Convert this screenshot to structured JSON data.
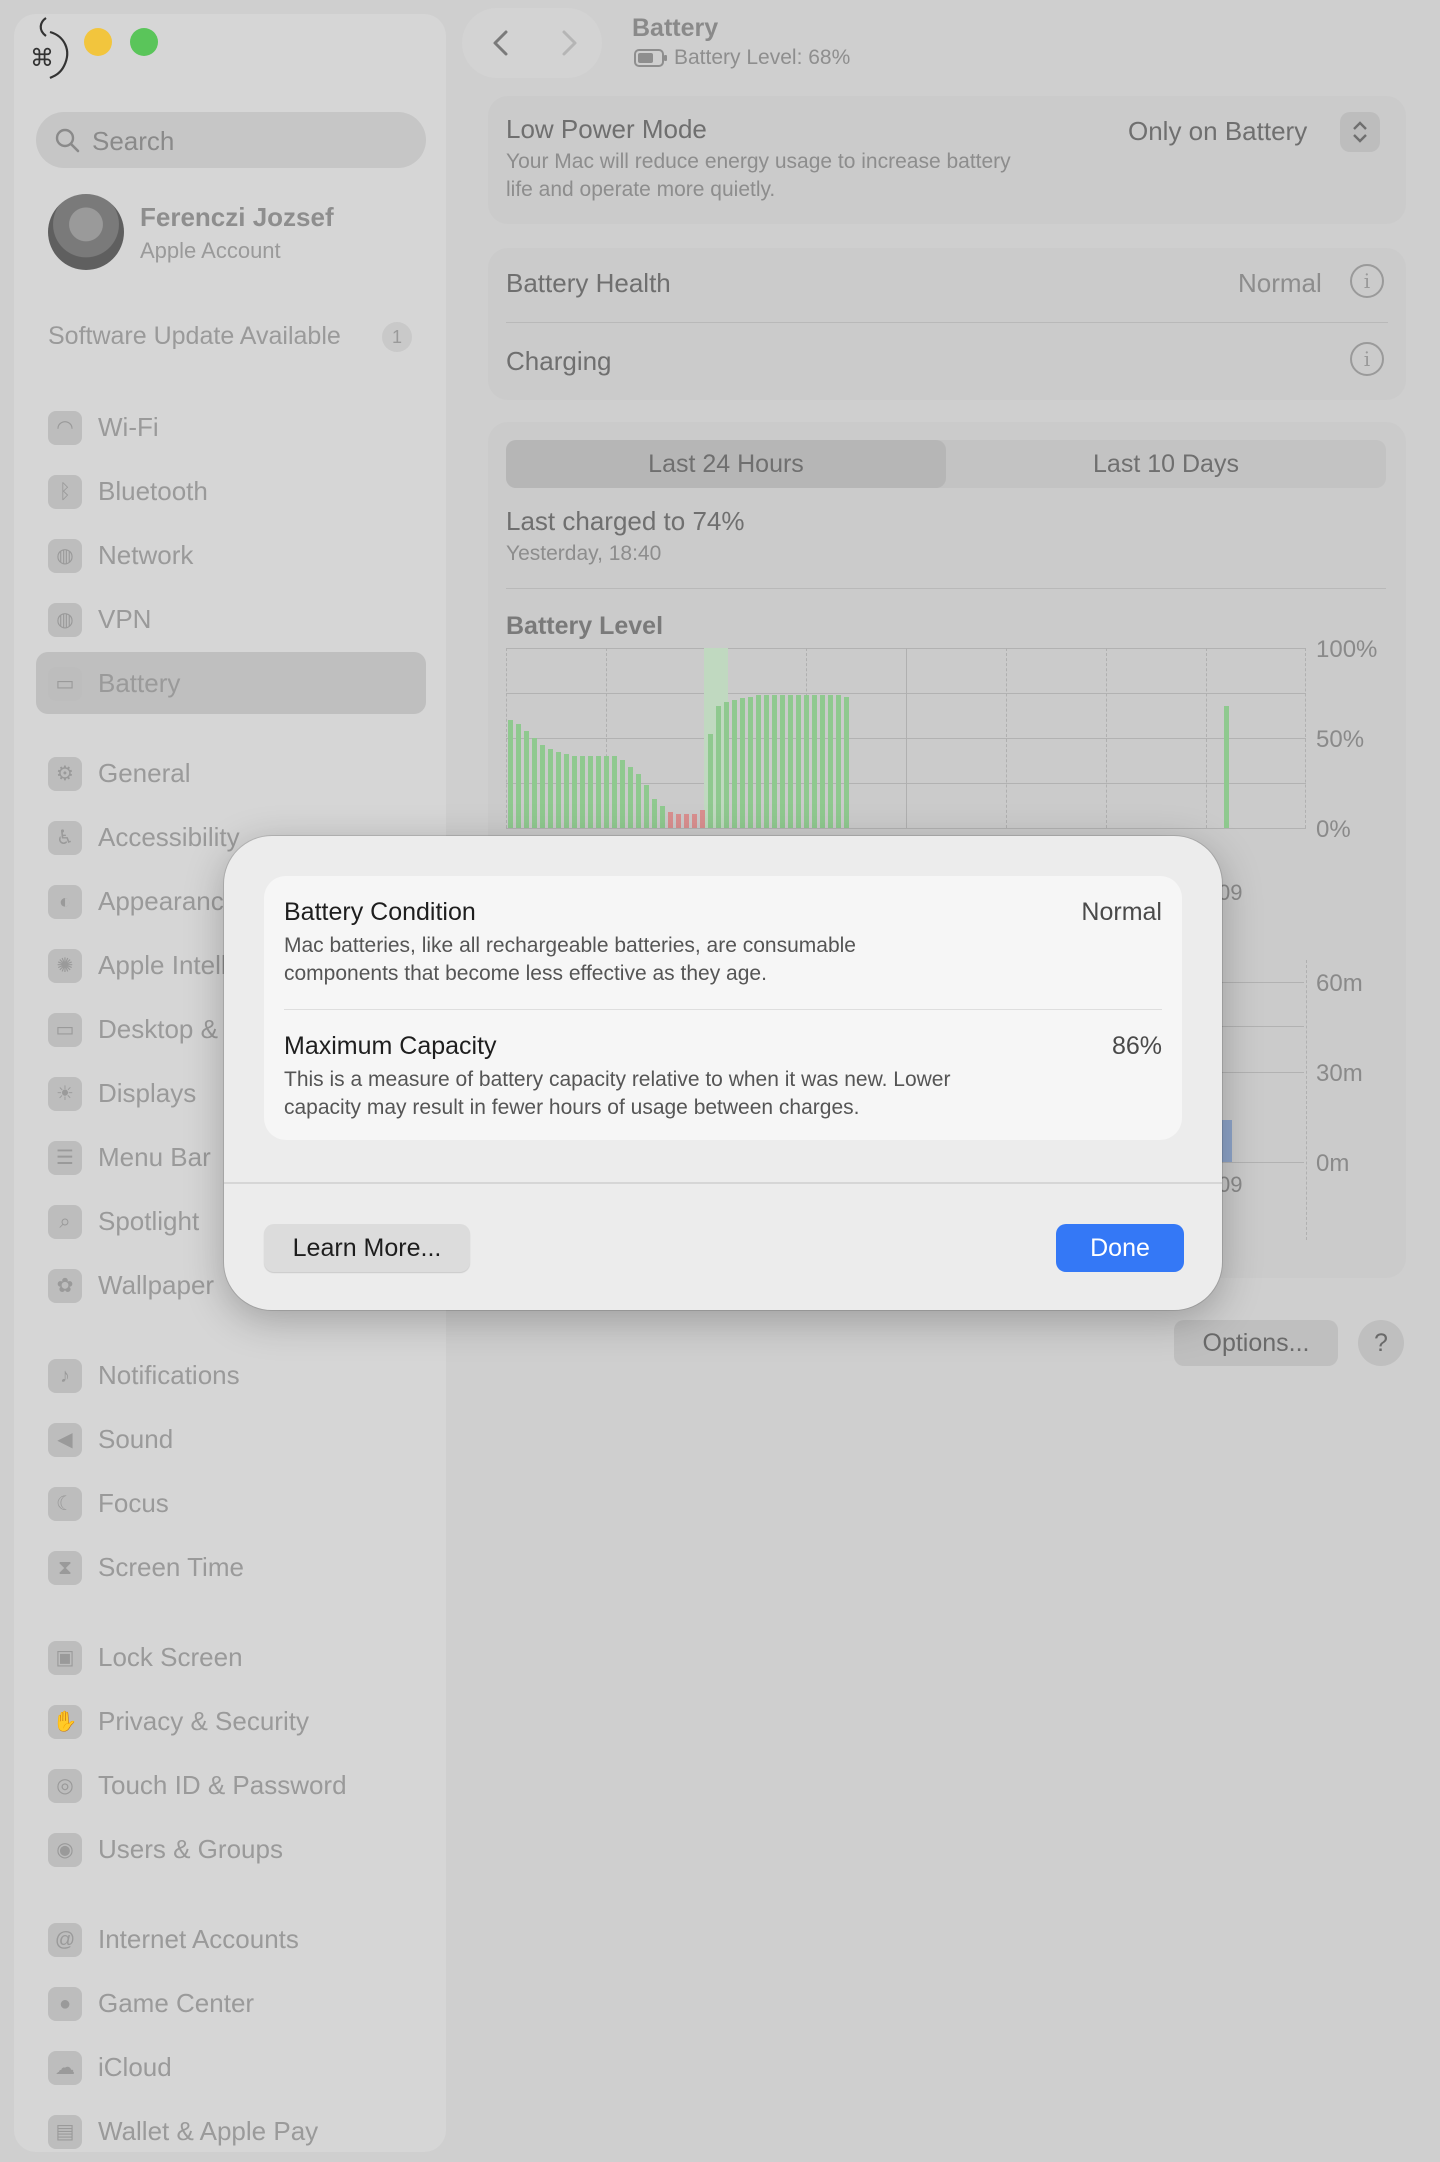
{
  "window": {
    "title": "Battery",
    "subtitle": "Battery Level: 68%"
  },
  "sidebar": {
    "search_placeholder": "Search",
    "account": {
      "name": "Ferenczi Jozsef",
      "subtitle": "Apple Account"
    },
    "software_update": {
      "label": "Software Update Available",
      "count": "1"
    },
    "items": [
      {
        "label": "Wi-Fi",
        "icon": "wifi-icon",
        "glyph": "◠"
      },
      {
        "label": "Bluetooth",
        "icon": "bluetooth-icon",
        "glyph": "ᛒ"
      },
      {
        "label": "Network",
        "icon": "globe-icon",
        "glyph": "◍"
      },
      {
        "label": "VPN",
        "icon": "vpn-globe-icon",
        "glyph": "◍"
      },
      {
        "label": "Battery",
        "icon": "battery-icon",
        "glyph": "▭"
      },
      {
        "label": "General",
        "icon": "gear-icon",
        "glyph": "⚙"
      },
      {
        "label": "Accessibility",
        "icon": "accessibility-icon",
        "glyph": "♿"
      },
      {
        "label": "Appearance",
        "icon": "appearance-icon",
        "glyph": "◐"
      },
      {
        "label": "Apple Intelligence & Siri",
        "icon": "siri-icon",
        "glyph": "✺"
      },
      {
        "label": "Desktop & Dock",
        "icon": "desktop-icon",
        "glyph": "▭"
      },
      {
        "label": "Displays",
        "icon": "displays-icon",
        "glyph": "☀"
      },
      {
        "label": "Menu Bar",
        "icon": "menu-bar-icon",
        "glyph": "☰"
      },
      {
        "label": "Spotlight",
        "icon": "spotlight-icon",
        "glyph": "⌕"
      },
      {
        "label": "Wallpaper",
        "icon": "wallpaper-icon",
        "glyph": "✿"
      },
      {
        "label": "Notifications",
        "icon": "bell-icon",
        "glyph": "♪"
      },
      {
        "label": "Sound",
        "icon": "speaker-icon",
        "glyph": "◀"
      },
      {
        "label": "Focus",
        "icon": "moon-icon",
        "glyph": "☾"
      },
      {
        "label": "Screen Time",
        "icon": "hourglass-icon",
        "glyph": "⧗"
      },
      {
        "label": "Lock Screen",
        "icon": "lock-icon",
        "glyph": "▣"
      },
      {
        "label": "Privacy & Security",
        "icon": "hand-icon",
        "glyph": "✋"
      },
      {
        "label": "Touch ID & Password",
        "icon": "fingerprint-icon",
        "glyph": "◎"
      },
      {
        "label": "Users & Groups",
        "icon": "users-icon",
        "glyph": "◉"
      },
      {
        "label": "Internet Accounts",
        "icon": "at-icon",
        "glyph": "@"
      },
      {
        "label": "Game Center",
        "icon": "game-center-icon",
        "glyph": "●"
      },
      {
        "label": "iCloud",
        "icon": "cloud-icon",
        "glyph": "☁"
      },
      {
        "label": "Wallet & Apple Pay",
        "icon": "wallet-icon",
        "glyph": "▤"
      }
    ]
  },
  "main": {
    "low_power": {
      "title": "Low Power Mode",
      "desc_line1": "Your Mac will reduce energy usage to increase battery",
      "desc_line2": "life and operate more quietly.",
      "value": "Only on Battery"
    },
    "battery_health": {
      "label": "Battery Health",
      "value": "Normal"
    },
    "charging": {
      "label": "Charging"
    },
    "tabs": [
      "Last 24 Hours",
      "Last 10 Days"
    ],
    "last_charged": {
      "title": "Last charged to 74%",
      "when": "Yesterday, 18:40"
    },
    "chart_title": "Battery Level",
    "y_ticks": [
      "100%",
      "50%",
      "0%"
    ],
    "usage_ticks": [
      "60m",
      "30m",
      "0m"
    ],
    "partial_time_label": "09",
    "options_label": "Options...",
    "help_label": "?"
  },
  "chart_data": {
    "type": "bar",
    "title": "Battery Level",
    "ylim": [
      0,
      100
    ],
    "y_ticks": [
      "100%",
      "50%",
      "0%"
    ],
    "values": [
      {
        "v": 60,
        "low": false
      },
      {
        "v": 58,
        "low": false
      },
      {
        "v": 54,
        "low": false
      },
      {
        "v": 50,
        "low": false
      },
      {
        "v": 46,
        "low": false
      },
      {
        "v": 44,
        "low": false
      },
      {
        "v": 42,
        "low": false
      },
      {
        "v": 41,
        "low": false
      },
      {
        "v": 40,
        "low": false
      },
      {
        "v": 40,
        "low": false
      },
      {
        "v": 40,
        "low": false
      },
      {
        "v": 40,
        "low": false
      },
      {
        "v": 40,
        "low": false
      },
      {
        "v": 40,
        "low": false
      },
      {
        "v": 38,
        "low": false
      },
      {
        "v": 34,
        "low": false
      },
      {
        "v": 30,
        "low": false
      },
      {
        "v": 24,
        "low": false
      },
      {
        "v": 16,
        "low": false
      },
      {
        "v": 12,
        "low": false
      },
      {
        "v": 9,
        "low": true
      },
      {
        "v": 8,
        "low": true
      },
      {
        "v": 8,
        "low": true
      },
      {
        "v": 8,
        "low": true
      },
      {
        "v": 10,
        "low": true
      },
      {
        "v": 52,
        "low": false
      },
      {
        "v": 68,
        "low": false
      },
      {
        "v": 70,
        "low": false
      },
      {
        "v": 71,
        "low": false
      },
      {
        "v": 72,
        "low": false
      },
      {
        "v": 73,
        "low": false
      },
      {
        "v": 74,
        "low": false
      },
      {
        "v": 74,
        "low": false
      },
      {
        "v": 74,
        "low": false
      },
      {
        "v": 74,
        "low": false
      },
      {
        "v": 74,
        "low": false
      },
      {
        "v": 74,
        "low": false
      },
      {
        "v": 74,
        "low": false
      },
      {
        "v": 74,
        "low": false
      },
      {
        "v": 74,
        "low": false
      },
      {
        "v": 74,
        "low": false
      },
      {
        "v": 74,
        "low": false
      },
      {
        "v": 73,
        "low": false
      }
    ],
    "late_bar": 68,
    "colors": {
      "normal": "#8fc98f",
      "low": "#d98f8f",
      "charging_band": "#c0d9c0"
    }
  },
  "modal": {
    "condition": {
      "title": "Battery Condition",
      "value": "Normal",
      "desc_line1": "Mac batteries, like all rechargeable batteries, are consumable",
      "desc_line2": "components that become less effective as they age."
    },
    "capacity": {
      "title": "Maximum Capacity",
      "value": "86%",
      "desc_line1": "This is a measure of battery capacity relative to when it was new. Lower",
      "desc_line2": "capacity may result in fewer hours of usage between charges."
    },
    "learn_more": "Learn More...",
    "done": "Done",
    "accent": "#3478f6"
  }
}
